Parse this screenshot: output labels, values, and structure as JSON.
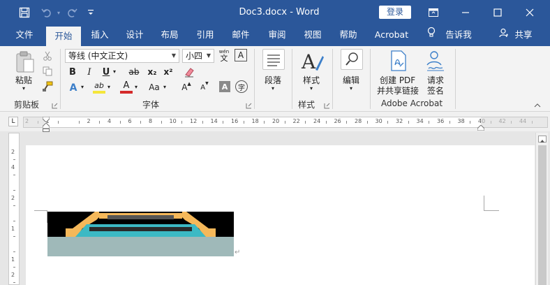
{
  "titlebar": {
    "doc_title": "Doc3.docx  -  Word",
    "login_label": "登录"
  },
  "tabs": {
    "items": [
      "文件",
      "开始",
      "插入",
      "设计",
      "布局",
      "引用",
      "邮件",
      "审阅",
      "视图",
      "帮助",
      "Acrobat"
    ],
    "active": "开始",
    "tell_me": "告诉我",
    "share": "共享"
  },
  "clipboard": {
    "paste_label": "粘贴",
    "group_label": "剪贴板"
  },
  "font": {
    "font_name": "等线 (中文正文)",
    "font_size": "小四",
    "group_label": "字体",
    "wen_label": "wén",
    "wen_char": "文",
    "bold": "B",
    "italic": "I",
    "underline": "U",
    "strike": "ab",
    "subscript": "x₂",
    "superscript": "x²",
    "text_effect": "A",
    "highlight": "ab",
    "font_color": "A",
    "change_case": "Aa",
    "grow": "A",
    "shrink": "A",
    "char_shade": "A",
    "enclose": "字"
  },
  "paragraph": {
    "label": "段落"
  },
  "styles": {
    "label": "样式",
    "group_label": "样式"
  },
  "editing": {
    "label": "编辑"
  },
  "acrobat": {
    "create_pdf_line1": "创建 PDF",
    "create_pdf_line2": "并共享链接",
    "request_sign_line1": "请求",
    "request_sign_line2": "签名",
    "group_label": "Adobe Acrobat"
  },
  "ruler": {
    "corner": "L",
    "h_labels": [
      "2",
      "1",
      "",
      "2",
      "4",
      "6",
      "8",
      "10",
      "12",
      "14",
      "16",
      "18",
      "20",
      "22",
      "24",
      "26",
      "28",
      "30",
      "32",
      "34",
      "36",
      "38",
      "40",
      "42",
      "44"
    ],
    "v_labels": [
      "2",
      "4",
      "",
      "2",
      "",
      "1",
      "",
      "1",
      "2"
    ]
  },
  "colors": {
    "brand": "#2b579a",
    "highlight_yellow": "#f5e63b",
    "font_red": "#d42a2a",
    "image_black": "#000000",
    "image_orange": "#f5b85a",
    "image_teal": "#3cb9c4",
    "image_gray": "#9fb9b9"
  }
}
